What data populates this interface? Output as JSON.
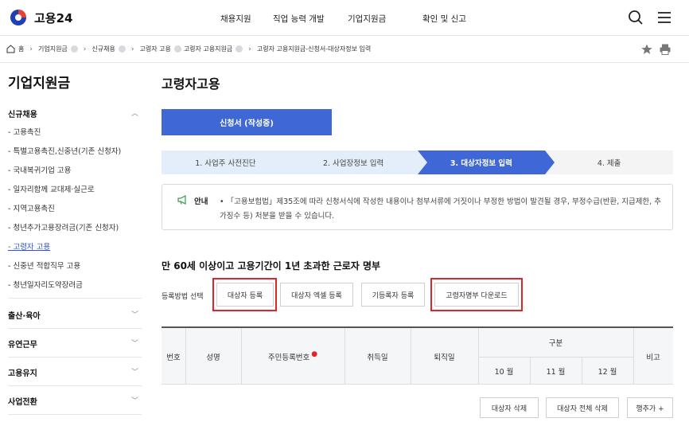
{
  "header": {
    "logo_text": "고용24",
    "nav": [
      "채용지원",
      "직업 능력 개발",
      "기업지원금",
      "확인 및 신고"
    ]
  },
  "breadcrumb": {
    "home": "홈",
    "items": [
      "기업지원금",
      "신규채용",
      "고령자 고용",
      "고령자 고용지원금",
      "고령자 고용지원금-신청서-대상자정보 입력"
    ]
  },
  "sidebar": {
    "title": "기업지원금",
    "section_new": "신규채용",
    "subitems": [
      "- 고용촉진",
      "- 특별고용촉진,신중년(기존 신청자)",
      "- 국내복귀기업 고용",
      "- 일자리함께 교대제·실근로",
      "- 지역고용촉진",
      "- 청년추가고용장려금(기존 신청자)",
      "- 고령자 고용",
      "- 신중년 적합직무 고용",
      "- 청년일자리도약장려금"
    ],
    "sections": [
      "출산·육아",
      "유연근무",
      "고용유지",
      "사업전환"
    ]
  },
  "main": {
    "title": "고령자고용",
    "apply_button": "신청서 (작성중)",
    "steps": [
      "1. 사업주 사전진단",
      "2. 사업장정보 입력",
      "3. 대상자정보 입력",
      "4. 제출"
    ],
    "notice_label": "안내",
    "notice_text": "• 「고용보험법」제35조에 따라 신청서식에 작성한 내용이나 첨부서류에 거짓이나 부정한 방법이 발견될 경우, 부정수급(반환, 지급제한, 추가징수 등) 처분을 받을 수 있습니다.",
    "section_title": "만 60세 이상이고 고용기간이 1년 초과한 근로자 명부",
    "reg_label": "등록방법 선택",
    "reg_buttons": [
      "대상자 등록",
      "대상자 엑셀 등록",
      "기등록자 등록",
      "고령자명부 다운로드"
    ],
    "table_headers": {
      "no": "번호",
      "name": "성명",
      "rrn": "주민등록번호",
      "acquired": "취득일",
      "lost": "퇴직일",
      "category": "구분",
      "months": [
        "10 월",
        "11 월",
        "12 월"
      ],
      "note": "비고"
    },
    "bottom_buttons": [
      "대상자 삭제",
      "대상자 전체 삭제",
      "행추가 +"
    ]
  },
  "colors": {
    "primary": "#3f68d6",
    "highlight": "#e0242a",
    "link": "#2d52d6"
  }
}
